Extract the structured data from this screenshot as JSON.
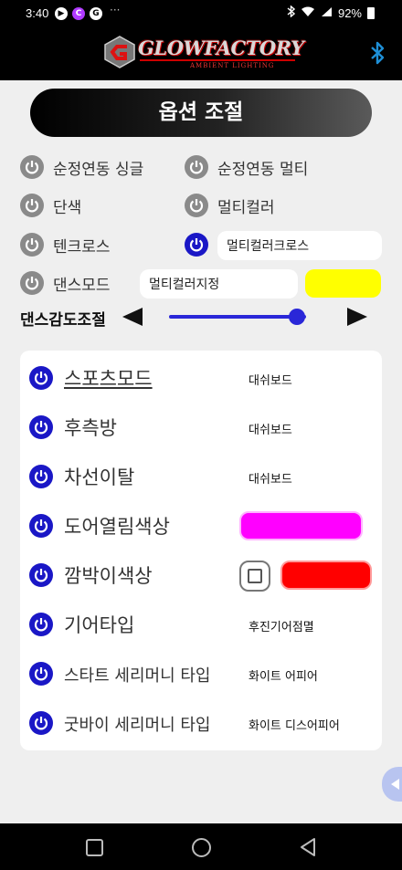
{
  "status_bar": {
    "time": "3:40",
    "left_icons": [
      "play-icon",
      "app-icon",
      "google-icon",
      "more-dots-icon"
    ],
    "battery": "92%",
    "right_icons": [
      "bluetooth-icon",
      "wifi-icon",
      "signal-icon",
      "battery-icon"
    ]
  },
  "header": {
    "brand": "GLOWFACTORY",
    "tagline": "AMBIENT LIGHTING",
    "bluetooth_icon": "bluetooth-icon"
  },
  "page_title": "옵션 조절",
  "options": {
    "pure_single": "순정연동 싱글",
    "pure_multi": "순정연동 멀티",
    "single_color": "단색",
    "multi_color": "멀티컬러",
    "techno_cross": "텐크로스",
    "multi_color_cross": "멀티컬러크로스",
    "dance_mode": "댄스모드",
    "multi_color_fixed": "멀티컬러지정"
  },
  "sensitivity": {
    "label": "댄스감도조절",
    "level": 0.93
  },
  "settings": [
    {
      "label": "스포츠모드",
      "value": "대쉬보드"
    },
    {
      "label": "후측방",
      "value": "대쉬보드"
    },
    {
      "label": "차선이탈",
      "value": "대쉬보드"
    },
    {
      "label": "도어열림색상",
      "value": ""
    },
    {
      "label": "깜박이색상",
      "value": ""
    },
    {
      "label": "기어타입",
      "value": "후진기어점멸"
    },
    {
      "label": "스타트 세리머니 타입",
      "value": "화이트 어피어"
    },
    {
      "label": "굿바이 세리머니 타입",
      "value": "화이트 디스어피어"
    }
  ],
  "colors": {
    "accent_blue": "#1a17c6",
    "dance_color": "#ffff00",
    "door_color": "#ff00ff",
    "blinker_color": "#ff0000"
  }
}
